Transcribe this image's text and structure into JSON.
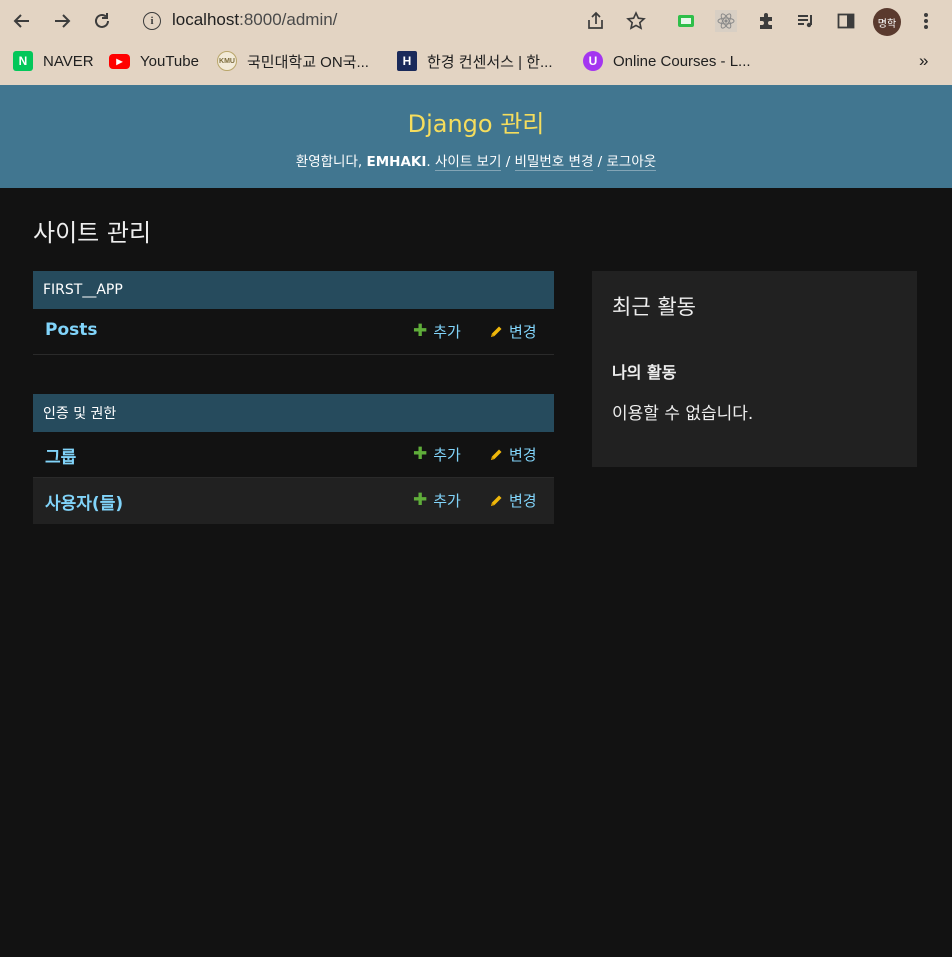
{
  "browser": {
    "url_host": "localhost",
    "url_path": ":8000/admin/",
    "profile_initials": "명학",
    "bookmarks": [
      {
        "icon": "naver-icon",
        "label": "NAVER",
        "color": "#03c75a",
        "glyph": "N"
      },
      {
        "icon": "youtube-icon",
        "label": "YouTube",
        "color": "#ff0000",
        "glyph": "▶"
      },
      {
        "icon": "kookmin-icon",
        "label": "국민대학교 ON국...",
        "color": "#c8b77a",
        "glyph": "K"
      },
      {
        "icon": "hankyung-icon",
        "label": "한경 컨센서스 | 한...",
        "color": "#1a2a5a",
        "glyph": "H"
      },
      {
        "icon": "udemy-icon",
        "label": "Online Courses - L...",
        "color": "#a435f0",
        "glyph": "U"
      }
    ],
    "more_bookmarks": "»"
  },
  "header": {
    "branding": "Django 관리",
    "welcome": "환영합니다,",
    "username": "EMHAKI",
    "view_site": "사이트 보기",
    "change_password": "비밀번호 변경",
    "logout": "로그아웃",
    "separator": "/"
  },
  "main": {
    "title": "사이트 관리",
    "modules": [
      {
        "caption": "FIRST__APP",
        "rows": [
          {
            "name": "Posts",
            "add": "추가",
            "change": "변경"
          }
        ]
      },
      {
        "caption": "인증 및 권한",
        "rows": [
          {
            "name": "그룹",
            "add": "추가",
            "change": "변경"
          },
          {
            "name": "사용자(들)",
            "add": "추가",
            "change": "변경"
          }
        ]
      }
    ]
  },
  "recent_actions": {
    "title": "최근 활동",
    "subtitle": "나의 활동",
    "empty": "이용할 수 없습니다."
  },
  "colors": {
    "header_bg": "#417690",
    "branding": "#f5dd5d",
    "caption_bg": "#264b5d",
    "link": "#81d4fa",
    "add_icon": "#5fad3a",
    "change_icon": "#efb80b",
    "body_bg": "#121212"
  }
}
